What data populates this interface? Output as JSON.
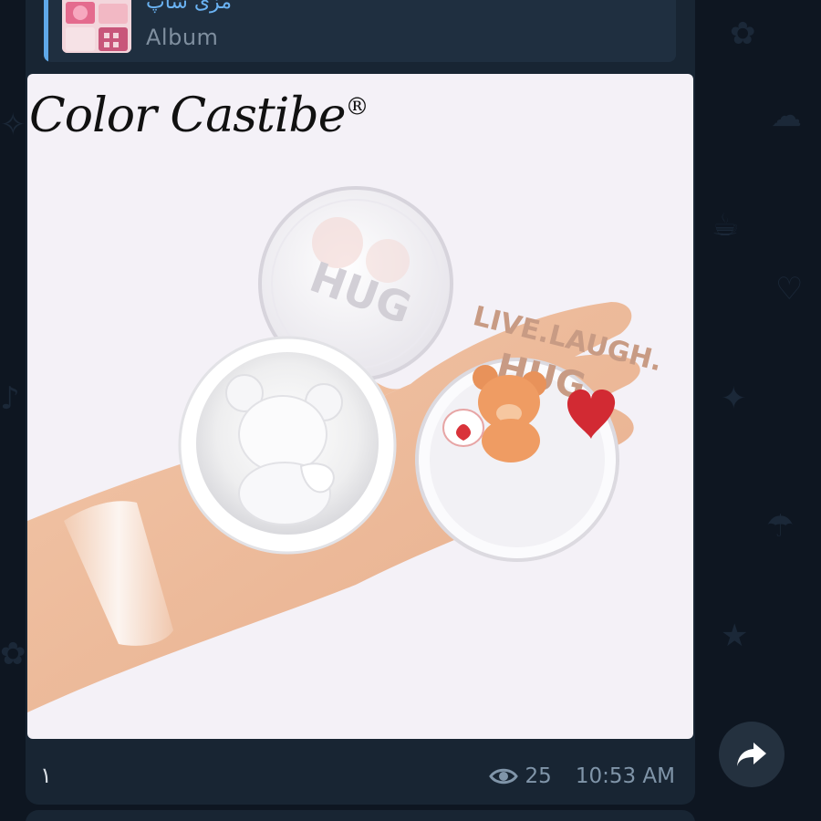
{
  "reply": {
    "title": "مزی شاپ",
    "subtitle": "Album"
  },
  "photo": {
    "brand_logo": "Color Castibe",
    "brand_mark": "®",
    "compact_lid_text_1": "LIVE.LAUGH.",
    "compact_lid_text_2": "HUG",
    "compact_lid_text_mirrored": "HUG"
  },
  "footer": {
    "count_label": "١",
    "views": "25",
    "time": "10:53 AM"
  },
  "icons": {
    "views": "eye-icon",
    "share": "share-arrow-icon"
  },
  "colors": {
    "background": "#0e1621",
    "bubble": "#182533",
    "accent": "#6ab2f2",
    "meta_text": "#8095a9"
  }
}
